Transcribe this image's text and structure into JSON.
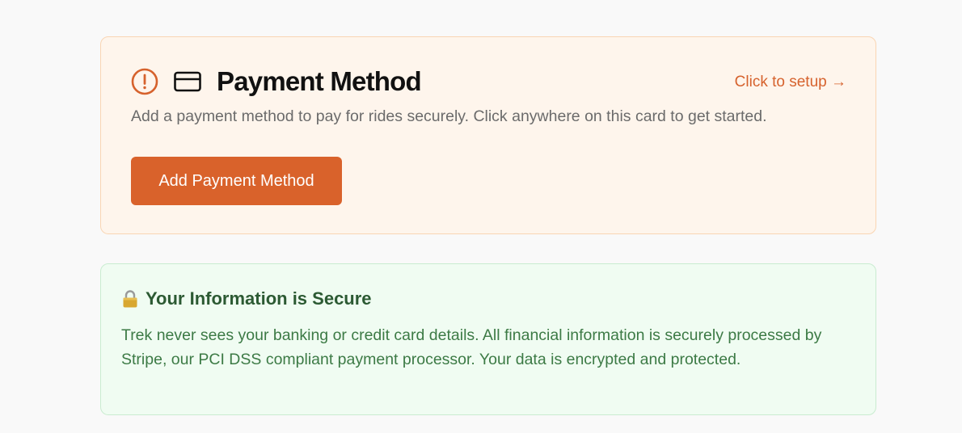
{
  "payment_card": {
    "title": "Payment Method",
    "setup_link": "Click to setup →",
    "description": "Add a payment method to pay for rides securely. Click anywhere on this card to get started.",
    "button_label": "Add Payment Method",
    "icons": [
      "alert-circle-icon",
      "credit-card-icon"
    ],
    "colors": {
      "accent": "#d9622b",
      "background": "#fef5ec",
      "border": "#f9d5b3"
    }
  },
  "secure_card": {
    "title": "Your Information is Secure",
    "icon": "lock-icon",
    "body": "Trek never sees your banking or credit card details. All financial information is securely processed by Stripe, our PCI DSS compliant payment processor. Your data is encrypted and protected.",
    "colors": {
      "title": "#2c5a33",
      "text": "#3c7a45",
      "background": "#f0fcf2",
      "border": "#c9ecd0"
    }
  }
}
